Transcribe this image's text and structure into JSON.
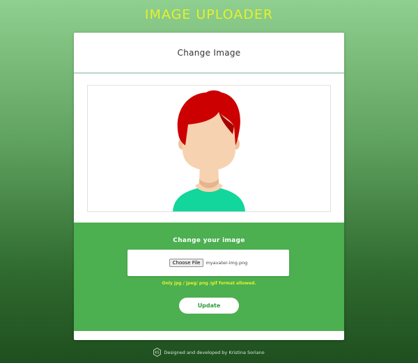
{
  "app": {
    "title": "IMAGE UPLOADER"
  },
  "card": {
    "header_title": "Change Image",
    "avatar": {
      "hair_color": "#cc0000",
      "skin_color": "#f7d2b0",
      "shirt_color": "#12d69b"
    }
  },
  "upload": {
    "label": "Change your image",
    "choose_button": "Choose File",
    "file_name": "myavater-img.png",
    "hint": "Only jpg / jpeg/ png /gif format allowed.",
    "update_button": "Update"
  },
  "footer": {
    "logo_text": "KS",
    "credit": "Designed and developed by Kristina Soriano"
  },
  "colors": {
    "accent_yellow": "#e4f22a",
    "panel_green": "#4caf50"
  }
}
